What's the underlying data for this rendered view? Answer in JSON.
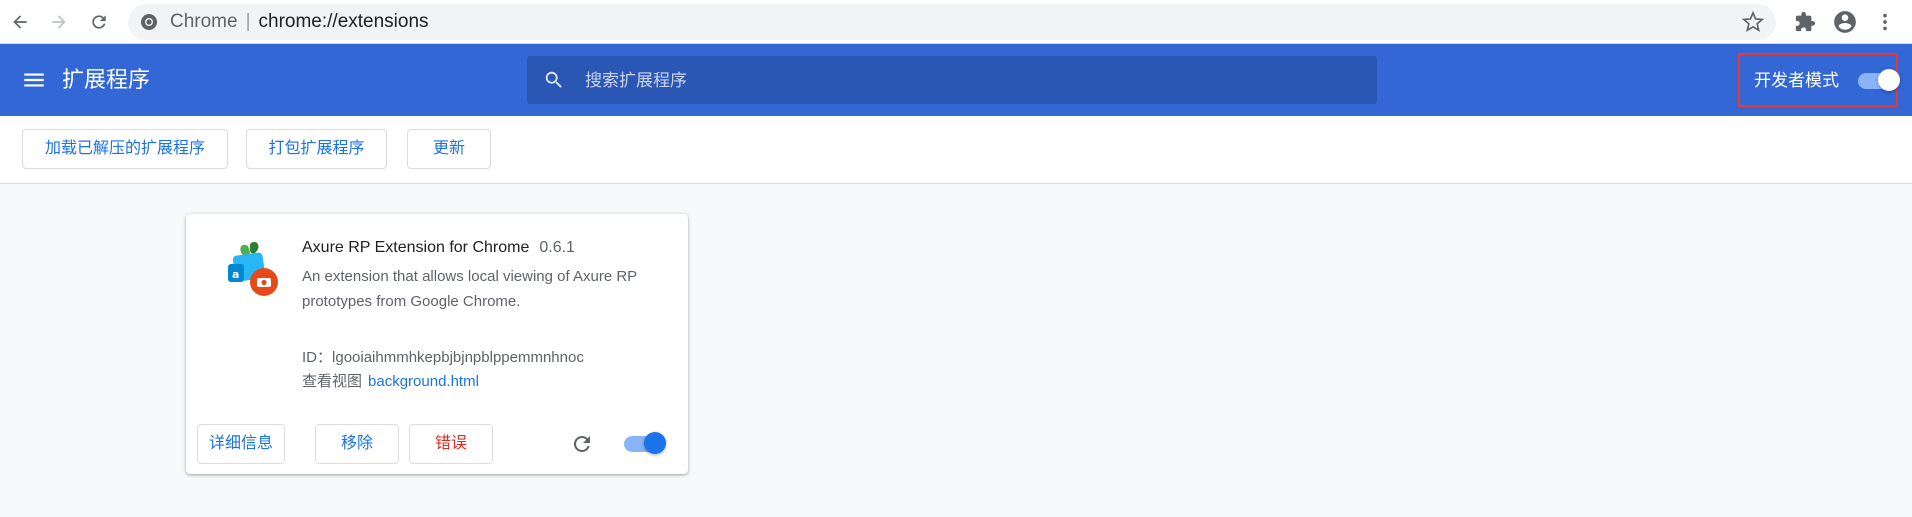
{
  "browser": {
    "site_name": "Chrome",
    "url": "chrome://extensions"
  },
  "header": {
    "title": "扩展程序",
    "search_placeholder": "搜索扩展程序",
    "dev_mode_label": "开发者模式",
    "dev_mode_enabled": true
  },
  "actions": {
    "load_unpacked": "加载已解压的扩展程序",
    "pack": "打包扩展程序",
    "update": "更新"
  },
  "extension": {
    "name": "Axure RP Extension for Chrome",
    "version": "0.6.1",
    "description": "An extension that allows local viewing of Axure RP prototypes from Google Chrome.",
    "id_label": "ID：",
    "id_value": "lgooiaihmmhkepbjbjnpblppemmnhnoc",
    "views_label": "查看视图",
    "views_link": "background.html",
    "details_button": "详细信息",
    "remove_button": "移除",
    "errors_button": "错误",
    "enabled": true
  },
  "colors": {
    "header_blue": "#3367d6",
    "accent_blue": "#1a73e8",
    "error_red": "#d93025",
    "highlight_red": "#e53935"
  },
  "icons": [
    "back-icon",
    "forward-icon",
    "reload-icon",
    "chrome-logo-icon",
    "star-icon",
    "extensions-puzzle-icon",
    "account-icon",
    "more-vert-icon",
    "menu-icon",
    "search-icon",
    "axure-extension-icon",
    "extension-reload-icon"
  ]
}
